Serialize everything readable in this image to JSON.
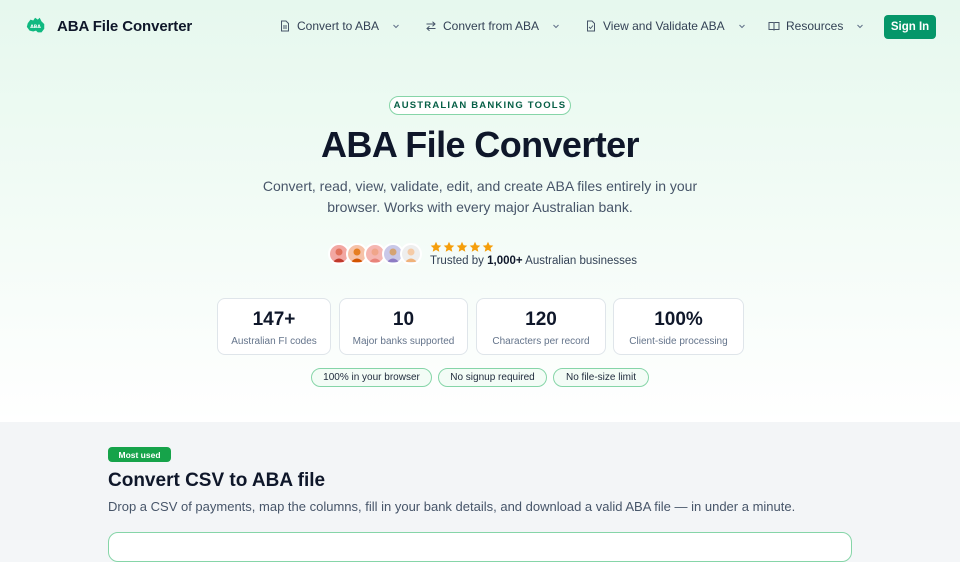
{
  "brand": {
    "name": "ABA File Converter",
    "logo_icon": "australia-map-logo",
    "logo_badge": "ABA",
    "accent": "#059669"
  },
  "nav": {
    "items": [
      {
        "label": "Convert to ABA",
        "icon": "file-icon"
      },
      {
        "label": "Convert from ABA",
        "icon": "swap-arrows-icon"
      },
      {
        "label": "View and Validate ABA",
        "icon": "file-check-icon"
      },
      {
        "label": "Resources",
        "icon": "book-icon"
      }
    ],
    "signin_label": "Sign In"
  },
  "hero": {
    "badge": "AUSTRALIAN BANKING TOOLS",
    "title": "ABA File Converter",
    "subtitle": "Convert, read, view, validate, edit, and create ABA files entirely in your browser. Works with every major Australian bank.",
    "rating_stars": 5,
    "trusted_prefix": "Trusted by",
    "trusted_count": "1,000+",
    "trusted_suffix": "Australian businesses",
    "star_color": "#f59e0b"
  },
  "stats": [
    {
      "value": "147+",
      "label": "Australian FI codes"
    },
    {
      "value": "10",
      "label": "Major banks supported"
    },
    {
      "value": "120",
      "label": "Characters per record"
    },
    {
      "value": "100%",
      "label": "Client-side processing"
    }
  ],
  "pills": [
    "100% in your browser",
    "No signup required",
    "No file-size limit"
  ],
  "section": {
    "badge": "Most used",
    "title": "Convert CSV to ABA file",
    "description": "Drop a CSV of payments, map the columns, fill in your bank details, and download a valid ABA file — in under a minute."
  }
}
